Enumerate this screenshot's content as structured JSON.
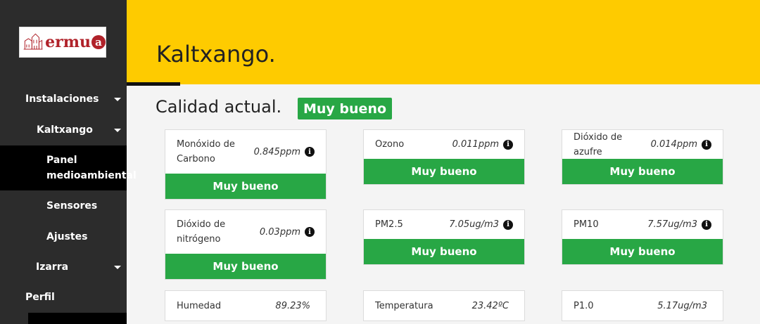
{
  "logo": {
    "text": "ermu",
    "badge": "a"
  },
  "sidebar": {
    "items": [
      {
        "label": "Instalaciones",
        "caret": true
      },
      {
        "label": "Kaltxango",
        "caret": true
      },
      {
        "label": "Panel medioambiental",
        "active": true
      },
      {
        "label": "Sensores"
      },
      {
        "label": "Ajustes"
      },
      {
        "label": "Izarra",
        "caret": true
      },
      {
        "label": "Perfil"
      }
    ]
  },
  "header": {
    "title": "Kaltxango."
  },
  "main": {
    "section_title": "Calidad actual.",
    "overall_status": "Muy bueno",
    "cards": [
      {
        "label": "Monóxido de Carbono",
        "value": "0.845ppm",
        "info": true,
        "status": "Muy bueno"
      },
      {
        "label": "Ozono",
        "value": "0.011ppm",
        "info": true,
        "status": "Muy bueno"
      },
      {
        "label": "Dióxido de azufre",
        "value": "0.014ppm",
        "info": true,
        "status": "Muy bueno"
      },
      {
        "label": "Dióxido de nitrógeno",
        "value": "0.03ppm",
        "info": true,
        "status": "Muy bueno"
      },
      {
        "label": "PM2.5",
        "value": "7.05ug/m3",
        "info": true,
        "status": "Muy bueno"
      },
      {
        "label": "PM10",
        "value": "7.57ug/m3",
        "info": true,
        "status": "Muy bueno"
      },
      {
        "label": "Humedad",
        "value": "89.23%"
      },
      {
        "label": "Temperatura",
        "value": "23.42ºC"
      },
      {
        "label": "P1.0",
        "value": "5.17ug/m3"
      }
    ]
  },
  "colors": {
    "accent": "#fecb00",
    "good": "#28a745",
    "sidebar": "#2c2c2c"
  },
  "icons": {
    "info": "info-circle-icon",
    "caret": "caret-down-icon"
  }
}
